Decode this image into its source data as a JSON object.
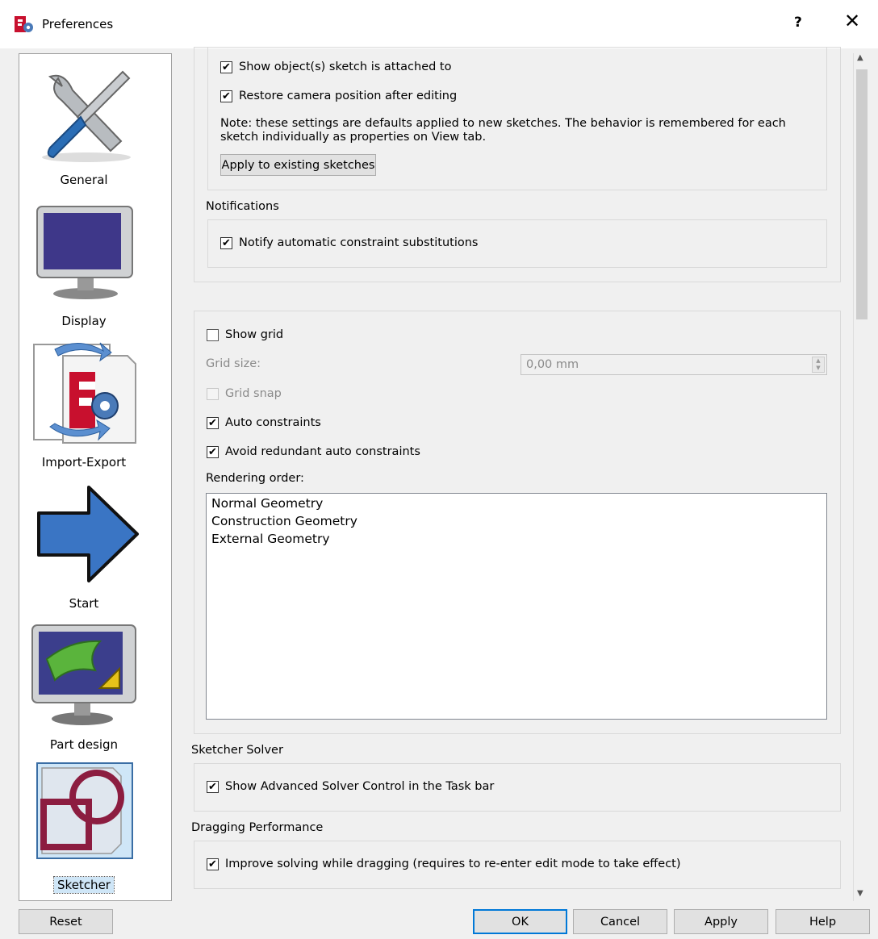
{
  "window": {
    "title": "Preferences",
    "help_label": "?",
    "close_label": "✕",
    "icon": "freecad-prefs-icon"
  },
  "sidebar": {
    "items": [
      {
        "label": "General",
        "icon": "tools-icon"
      },
      {
        "label": "Display",
        "icon": "monitor-icon"
      },
      {
        "label": "Import-Export",
        "icon": "import-export-icon"
      },
      {
        "label": "Start",
        "icon": "arrow-right-icon"
      },
      {
        "label": "Part design",
        "icon": "part-design-icon"
      },
      {
        "label": "Sketcher",
        "icon": "sketcher-icon",
        "selected": true
      }
    ]
  },
  "sketch_options": {
    "show_attached": {
      "label": "Show object(s) sketch is attached to",
      "checked": true
    },
    "restore_camera": {
      "label": "Restore camera position after editing",
      "checked": true
    },
    "note": "Note: these settings are defaults applied to new sketches. The behavior is remembered for each sketch individually as properties on View tab.",
    "apply_existing_label": "Apply to existing sketches"
  },
  "notifications": {
    "title": "Notifications",
    "notify_substitutions": {
      "label": "Notify automatic constraint substitutions",
      "checked": true
    }
  },
  "grid": {
    "show_grid": {
      "label": "Show grid",
      "checked": false
    },
    "grid_size_label": "Grid size:",
    "grid_size_value": "0,00 mm",
    "grid_snap": {
      "label": "Grid snap",
      "checked": false
    },
    "auto_constraints": {
      "label": "Auto constraints",
      "checked": true
    },
    "avoid_redundant": {
      "label": "Avoid redundant auto constraints",
      "checked": true
    },
    "rendering_order_label": "Rendering order:",
    "rendering_order": [
      "Normal Geometry",
      "Construction Geometry",
      "External Geometry"
    ]
  },
  "solver": {
    "title": "Sketcher Solver",
    "advanced_control": {
      "label": "Show Advanced Solver Control in the Task bar",
      "checked": true
    }
  },
  "dragging": {
    "title": "Dragging Performance",
    "improve_solving": {
      "label": "Improve solving while dragging (requires to re-enter edit mode to take effect)",
      "checked": true
    }
  },
  "footer": {
    "reset": "Reset",
    "ok": "OK",
    "cancel": "Cancel",
    "apply": "Apply",
    "help": "Help"
  },
  "check_glyph": "✔"
}
